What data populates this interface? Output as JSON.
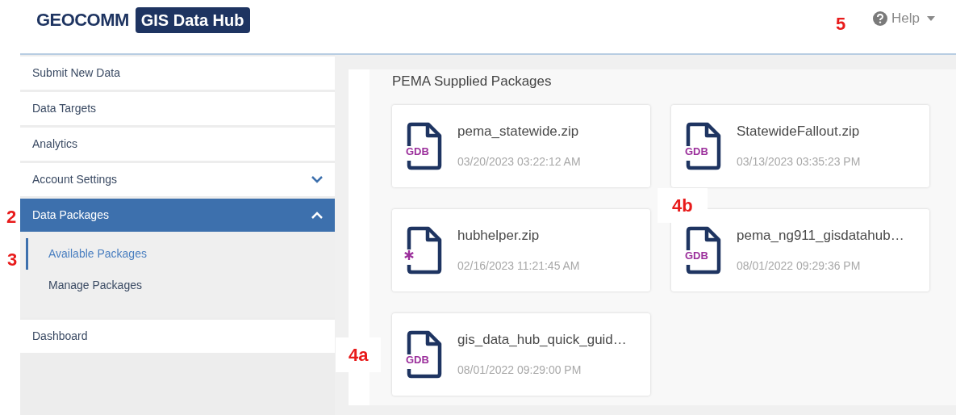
{
  "header": {
    "logo": "GEOCOMM",
    "badge": "GIS Data Hub",
    "help": "Help"
  },
  "sidebar": {
    "items": [
      {
        "label": "Submit New Data",
        "selected": false
      },
      {
        "label": "Data Targets",
        "selected": false
      },
      {
        "label": "Analytics",
        "selected": false
      },
      {
        "label": "Account Settings",
        "selected": false,
        "expanded": false
      },
      {
        "label": "Data Packages",
        "selected": true,
        "expanded": true,
        "children": [
          {
            "label": "Available Packages",
            "selected": true
          },
          {
            "label": "Manage Packages",
            "selected": false
          }
        ]
      },
      {
        "label": "Dashboard",
        "selected": false
      }
    ]
  },
  "main": {
    "title": "PEMA Supplied Packages",
    "packages": [
      {
        "name": "pema_statewide.zip",
        "date": "03/20/2023 03:22:12 AM",
        "kind": "gdb",
        "icon_label": "GDB"
      },
      {
        "name": "StatewideFallout.zip",
        "date": "03/13/2023 03:35:23 PM",
        "kind": "gdb",
        "icon_label": "GDB"
      },
      {
        "name": "hubhelper.zip",
        "date": "02/16/2023 11:21:45 AM",
        "kind": "generic"
      },
      {
        "name": "pema_ng911_gisdatahub…",
        "date": "08/01/2022 09:29:36 PM",
        "kind": "gdb",
        "icon_label": "GDB"
      },
      {
        "name": "gis_data_hub_quick_guid…",
        "date": "08/01/2022 09:29:00 PM",
        "kind": "gdb",
        "icon_label": "GDB"
      }
    ]
  },
  "callouts": [
    {
      "label": "2"
    },
    {
      "label": "3"
    },
    {
      "label": "4a"
    },
    {
      "label": "4b"
    },
    {
      "label": "5"
    }
  ]
}
